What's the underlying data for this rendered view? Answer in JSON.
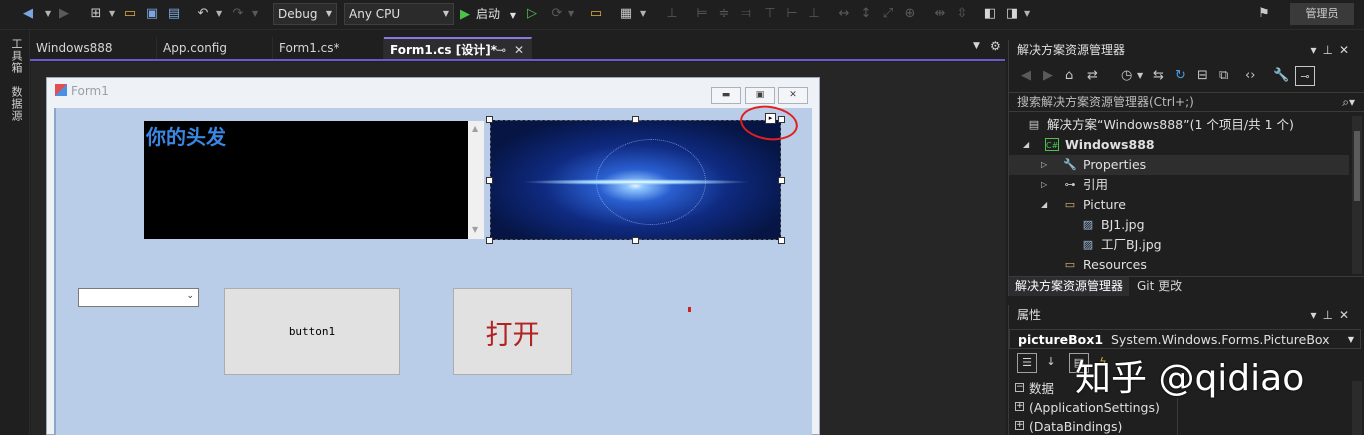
{
  "toolbar": {
    "config": "Debug",
    "platform": "Any CPU",
    "start_label": "启动",
    "admin_label": "管理员"
  },
  "left_strip": {
    "toolbox": "工具箱",
    "datasource": "数据源"
  },
  "doc_tabs": [
    {
      "label": "Windows888",
      "active": false
    },
    {
      "label": "App.config",
      "active": false
    },
    {
      "label": "Form1.cs*",
      "active": false
    },
    {
      "label": "Form1.cs [设计]*",
      "active": true
    }
  ],
  "form": {
    "title": "Form1",
    "richtext": "你的头发",
    "combobox_value": "",
    "button1_label": "button1",
    "open_button_label": "打开"
  },
  "solution_explorer": {
    "title": "解决方案资源管理器",
    "search_placeholder": "搜索解决方案资源管理器(Ctrl+;)",
    "tree": [
      {
        "label": "解决方案“Windows888”(1 个项目/共 1 个)",
        "icon": "solution-icon",
        "level": 0
      },
      {
        "label": "Windows888",
        "icon": "csharp-project-icon",
        "level": 1,
        "bold": true,
        "expanded": true
      },
      {
        "label": "Properties",
        "icon": "wrench-icon",
        "level": 2,
        "expanded": false,
        "selected": true
      },
      {
        "label": "引用",
        "icon": "references-icon",
        "level": 2,
        "expanded": false
      },
      {
        "label": "Picture",
        "icon": "folder-icon",
        "level": 2,
        "expanded": true
      },
      {
        "label": "BJ1.jpg",
        "icon": "image-file-icon",
        "level": 3
      },
      {
        "label": "工厂BJ.jpg",
        "icon": "image-file-icon",
        "level": 3
      },
      {
        "label": "Resources",
        "icon": "folder-icon",
        "level": 2
      }
    ],
    "tabs": [
      "解决方案资源管理器",
      "Git 更改"
    ]
  },
  "properties": {
    "title": "属性",
    "object_name": "pictureBox1",
    "object_type": "System.Windows.Forms.PictureBox",
    "category": "数据",
    "rows": [
      "(ApplicationSettings)",
      "(DataBindings)"
    ]
  },
  "watermark": "知乎 @qidiao",
  "colors": {
    "accent": "#6a5acd",
    "form_client": "#b9cde8",
    "open_button_text": "#b22222",
    "annotation_red": "#e02020"
  }
}
